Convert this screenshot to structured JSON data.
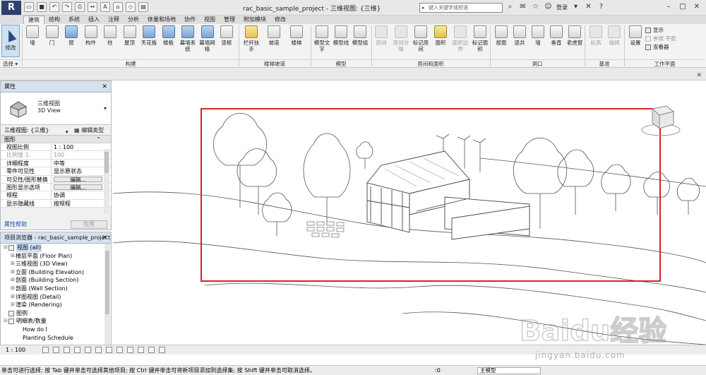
{
  "titlebar": {
    "app_logo": "R",
    "doc_title": "rac_basic_sample_project - 三维视图: {三维}",
    "search_placeholder": "键入关键字或短语",
    "login_label": "登录"
  },
  "ribbon_tabs": [
    "建筑",
    "结构",
    "系统",
    "插入",
    "注释",
    "分析",
    "体量和场地",
    "协作",
    "视图",
    "管理",
    "附加模块",
    "修改"
  ],
  "active_tab": "建筑",
  "ribbon": {
    "modify_label": "修改",
    "select_label": "选择 ▾",
    "build_tools": [
      "墙",
      "门",
      "窗",
      "构件",
      "柱",
      "屋顶",
      "天花板",
      "楼板",
      "幕墙系统",
      "幕墙网格",
      "竖梃"
    ],
    "build_group": "构建",
    "stair_tools": [
      "栏杆扶手",
      "坡道",
      "楼梯"
    ],
    "stair_group": "楼梯坡道",
    "model_tools": [
      "模型文字",
      "模型线",
      "模型组"
    ],
    "model_group": "模型",
    "room_tools": [
      "房间",
      "房间分隔",
      "标记房间",
      "面积",
      "面积边界",
      "标记面积"
    ],
    "room_group": "房间和面积",
    "opening_tools": [
      "按面",
      "竖井",
      "墙",
      "垂直",
      "老虎窗"
    ],
    "opening_group": "洞口",
    "datum_tools": [
      "标高",
      "轴网"
    ],
    "datum_group": "基准",
    "workplane_tools": [
      "设置"
    ],
    "workplane_small": [
      "显示",
      "参照 平面",
      "查看器"
    ],
    "workplane_group": "工作平面"
  },
  "properties": {
    "header": "属性",
    "type_name_line1": "三维视图",
    "type_name_line2": "3D View",
    "view_selector": "三维视图: {三维}",
    "edit_type": "编辑类型",
    "category": "图形",
    "rows": [
      {
        "k": "视图比例",
        "v": "1 : 100",
        "muted": false
      },
      {
        "k": "比例值 1:",
        "v": "100",
        "muted": true
      },
      {
        "k": "详细程度",
        "v": "中等",
        "muted": false
      },
      {
        "k": "零件可见性",
        "v": "显示原状态",
        "muted": false
      },
      {
        "k": "可见性/图形替换",
        "btn": "编辑..."
      },
      {
        "k": "图形显示选项",
        "btn": "编辑..."
      },
      {
        "k": "规程",
        "v": "协调",
        "muted": false
      },
      {
        "k": "显示隐藏线",
        "v": "按规程",
        "muted": false
      }
    ],
    "help_link": "属性帮助",
    "apply": "应用"
  },
  "browser": {
    "header": "项目浏览器 - rac_basic_sample_project",
    "items": [
      {
        "label": "视图 (all)",
        "level": 0,
        "exp": "⊟",
        "selected": true
      },
      {
        "label": "楼层平面 (Floor Plan)",
        "level": 1,
        "exp": "⊞"
      },
      {
        "label": "三维视图 (3D View)",
        "level": 1,
        "exp": "⊞"
      },
      {
        "label": "立面 (Building Elevation)",
        "level": 1,
        "exp": "⊞"
      },
      {
        "label": "剖面 (Building Section)",
        "level": 1,
        "exp": "⊞"
      },
      {
        "label": "剖面 (Wall Section)",
        "level": 1,
        "exp": "⊞"
      },
      {
        "label": "详图视图 (Detail)",
        "level": 1,
        "exp": "⊞"
      },
      {
        "label": "渲染 (Rendering)",
        "level": 1,
        "exp": "⊞"
      },
      {
        "label": "图例",
        "level": 0,
        "exp": ""
      },
      {
        "label": "明细表/数量",
        "level": 0,
        "exp": "⊟"
      },
      {
        "label": "How do I",
        "level": 2,
        "exp": ""
      },
      {
        "label": "Planting Schedule",
        "level": 2,
        "exp": ""
      }
    ]
  },
  "viewbar": {
    "scale": "1 : 100"
  },
  "status": {
    "message": "单击可进行选择; 按 Tab 键并单击可选择其他项目; 按 Ctrl 键并单击可将新项目添加到选择集; 按 Shift 键并单击可取消选择。",
    "position": ":0",
    "model": "主模型"
  },
  "watermark": {
    "text": "jingyan.baidu.com"
  },
  "colors": {
    "selection": "#d9222a",
    "accent": "#2e3e6e"
  }
}
